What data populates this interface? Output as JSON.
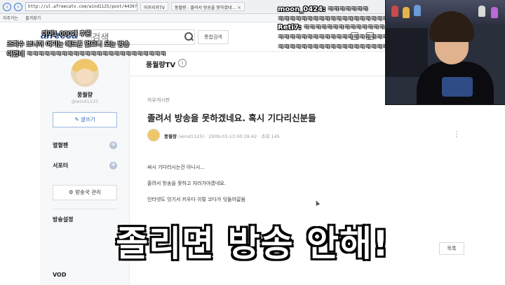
{
  "browser": {
    "url": "http://ul.afreecatv.com/wind1125/post/4439?page=1&t=",
    "tabs": [
      {
        "label": "아프리카TV"
      },
      {
        "label": "풍월량 - 졸려서 방송을 못하겠네..."
      }
    ],
    "bookmarks": [
      "자주가는",
      "즐겨찾기"
    ]
  },
  "header": {
    "logo": "afreeca",
    "search_placeholder": "검색",
    "unified_search_label": "통합검색"
  },
  "sidebar": {
    "profile_name": "풍월량",
    "profile_id": "@wind1125",
    "write_label": "글쓰기",
    "rows": [
      {
        "label": "열혈팬"
      },
      {
        "label": "서포터"
      }
    ],
    "manage_label": "방송국 관리",
    "settings_label": "방송설정",
    "vod_label": "VOD"
  },
  "channel": {
    "title": "풍월량TV",
    "info_glyph": "i"
  },
  "post": {
    "board": "자유게시판",
    "title": "졸려서 방송을 못하겠네요. 혹시 기다리신분들",
    "author": "풍월량",
    "author_id": "(wind1125)",
    "date": "2009-03-13 00:39:42",
    "views_label": "조회",
    "views": "145",
    "lines": [
      "싸시 기다리시는건 아니시...",
      "졸려서 방송을 못하고 자러가야겠네요.",
      "인터넷도 잇기서 키우다 이렇 코다가 잇돌어갈움"
    ],
    "list_button": "목록"
  },
  "chat": [
    {
      "text": "야이1 000개 후원"
    },
    {
      "text": "조회수 보니까 여기는 에드존 없으니 오는 방송"
    },
    {
      "text": "아였네 ㅋㅋㅋㅋㅋㅋㅋㅋㅋㅋㅋㅋㅋㅋㅋㅋㅋㅋㅋㅋㅋㅋㅋㅋ"
    },
    {
      "name": "moon_0424:",
      "text": "ㅋㅋㅋㅋㅋㅋㅋ"
    },
    {
      "text": "ㅋㅋㅋㅋㅋㅋㅋㅋㅋㅋㅋㅋㅋㅋㅋㅋㅋㅋㅋㅋㅋㅋㅋㅋ"
    },
    {
      "name": "Reti7:",
      "text": "ㅋㅋㅋㅋㅋㅋㅋㅋㅋㅋㅋㅋㅋㅋㅋㅋㅋ"
    },
    {
      "text": "ㅋㅋㅋㅋㅋㅋㅋㅋㅋㅋㅋㅋㅋㅋㅋㅋㅋㅋㅋㅋㅋㅋㅋㅋㅋㅋㅋㅋ"
    },
    {
      "text": "ㅋㅋㅋㅋㅋㅋㅋㅋㅋㅋㅋㅋㅋㅋㅋㅋㅋㅋㅋㅋㅋㅋㅋㅋㅋㅋㅋㅋ"
    }
  ],
  "caption": "졸리면 방송 안해!"
}
